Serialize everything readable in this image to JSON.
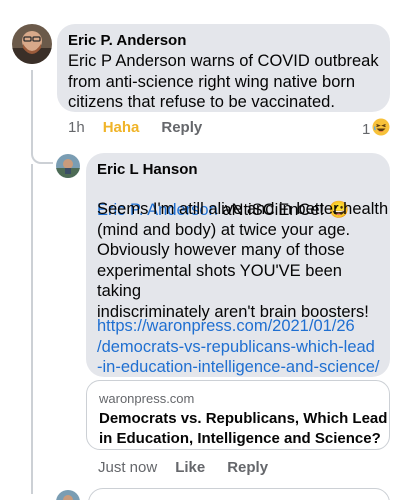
{
  "comment1": {
    "author": "Eric P. Anderson",
    "text": "Eric P Anderson warns of COVID outbreak\nfrom anti-science right wing native born\ncitizens that refuse to be vaccinated.",
    "time": "1h",
    "reaction_label": "Haha",
    "reply_label": "Reply",
    "reaction_count": "1",
    "reaction_icon": "laughing-emoji-icon"
  },
  "comment2": {
    "author": "Eric L Hanson",
    "mention": "Eric P. Anderson",
    "mention_suffix": " aNtiSCiEnCe!  😀",
    "text": "Seems I'm atill alive and in better health\n(mind and body) at twice your age.\nObviously however many of those\nexperimental shots YOU'VE  been taking\nindiscriminately aren't brain boosters!",
    "link": "https://waronpress.com/2021/01/26\n/democrats-vs-republicans-which-lead\n-in-education-intelligence-and-science/",
    "preview": {
      "domain": "waronpress.com",
      "title": "Democrats vs. Republicans, Which Lead in Education, Intelligence and Science?"
    },
    "time": "Just now",
    "like_label": "Like",
    "reply_label": "Reply"
  },
  "colors": {
    "bubble": "#e4e6eb",
    "link": "#1f6fd1",
    "haha": "#f0b429",
    "meta": "#65676b"
  }
}
